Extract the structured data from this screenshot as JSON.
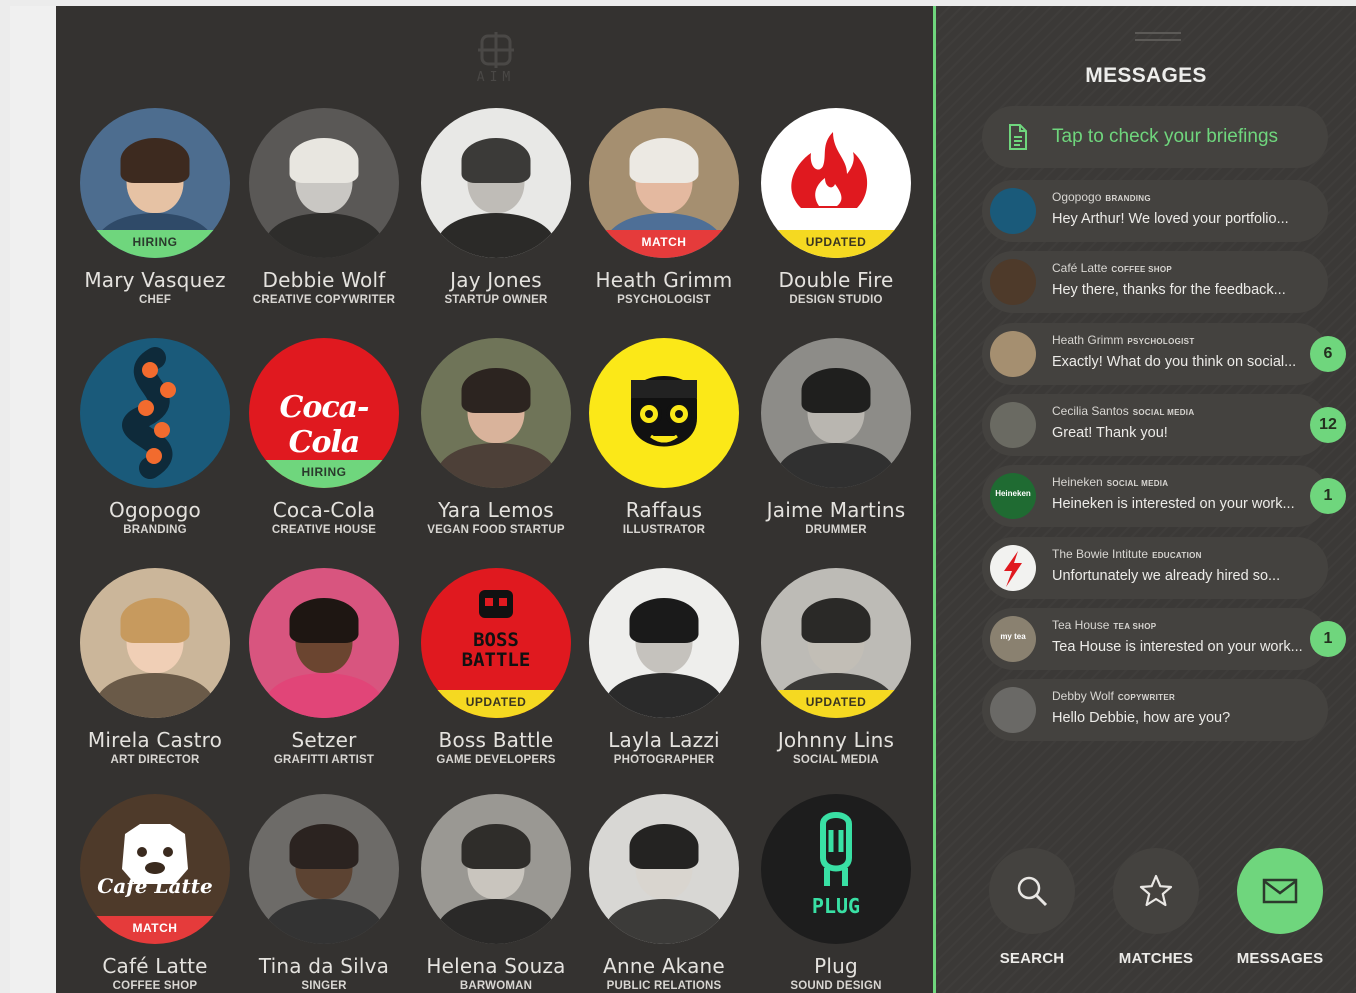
{
  "app": {
    "logo_text": "AIM"
  },
  "profiles": [
    {
      "name": "Mary Vasquez",
      "role": "CHEF",
      "badge": "HIRING",
      "badge_type": "hiring",
      "bg": "#4d6d8f",
      "skin": "#e6c2a4",
      "hair": "#3d2a1f",
      "shirt": "#2f4a68"
    },
    {
      "name": "Debbie Wolf",
      "role": "CREATIVE COPYWRITER",
      "badge": "",
      "badge_type": "",
      "bg": "#5a5856",
      "skin": "#c9c7c3",
      "hair": "#e8e6e0",
      "shirt": "#2e2d2b"
    },
    {
      "name": "Jay Jones",
      "role": "STARTUP OWNER",
      "badge": "",
      "badge_type": "",
      "bg": "#e8e8e6",
      "skin": "#bfbcb7",
      "hair": "#3b3a38",
      "shirt": "#2b2a28"
    },
    {
      "name": "Heath Grimm",
      "role": "PSYCHOLOGIST",
      "badge": "MATCH",
      "badge_type": "match",
      "bg": "#a58f70",
      "skin": "#e4b9a0",
      "hair": "#ece9e3",
      "shirt": "#4e6f97"
    },
    {
      "name": "Double Fire",
      "role": "DESIGN STUDIO",
      "badge": "UPDATED",
      "badge_type": "updated",
      "bg": "#ffffff",
      "logo": "fire"
    },
    {
      "name": "Ogopogo",
      "role": "BRANDING",
      "badge": "",
      "badge_type": "",
      "bg": "#1a5a7a",
      "logo": "ogopogo"
    },
    {
      "name": "Coca-Cola",
      "role": "CREATIVE HOUSE",
      "badge": "HIRING",
      "badge_type": "hiring",
      "bg": "#e0191f",
      "logo": "coke",
      "logo_text": "Coca-Cola"
    },
    {
      "name": "Yara Lemos",
      "role": "VEGAN FOOD STARTUP",
      "badge": "",
      "badge_type": "",
      "bg": "#6f7458",
      "skin": "#d9b39b",
      "hair": "#2c2420",
      "shirt": "#4d4038"
    },
    {
      "name": "Raffaus",
      "role": "ILLUSTRATOR",
      "badge": "",
      "badge_type": "",
      "bg": "#fbe818",
      "logo": "raffaus"
    },
    {
      "name": "Jaime Martins",
      "role": "DRUMMER",
      "badge": "",
      "badge_type": "",
      "bg": "#8d8c88",
      "skin": "#b9b6b0",
      "hair": "#1f1f1e",
      "shirt": "#303030"
    },
    {
      "name": "Mirela Castro",
      "role": "ART DIRECTOR",
      "badge": "",
      "badge_type": "",
      "bg": "#cbb69a",
      "skin": "#f0cfb6",
      "hair": "#c79a5e",
      "shirt": "#6a5a48"
    },
    {
      "name": "Setzer",
      "role": "GRAFITTI ARTIST",
      "badge": "",
      "badge_type": "",
      "bg": "#d8557f",
      "skin": "#6b4530",
      "hair": "#1e1612",
      "shirt": "#e14578"
    },
    {
      "name": "Boss Battle",
      "role": "GAME DEVELOPERS",
      "badge": "UPDATED",
      "badge_type": "updated",
      "bg": "#e0191f",
      "logo": "boss",
      "logo_text": "BOSS BATTLE"
    },
    {
      "name": "Layla Lazzi",
      "role": "PHOTOGRAPHER",
      "badge": "",
      "badge_type": "",
      "bg": "#eeeeec",
      "skin": "#c5c2bd",
      "hair": "#1a1a1a",
      "shirt": "#2a2a2a"
    },
    {
      "name": "Johnny Lins",
      "role": "SOCIAL MEDIA",
      "badge": "UPDATED",
      "badge_type": "updated",
      "bg": "#bdbbb6",
      "skin": "#c2beb6",
      "hair": "#2a2927",
      "shirt": "#3b3a38"
    },
    {
      "name": "Café Latte",
      "role": "COFFEE SHOP",
      "badge": "MATCH",
      "badge_type": "match",
      "bg": "#4e3a2a",
      "logo": "cafe",
      "logo_text": "Café Latte"
    },
    {
      "name": "Tina da Silva",
      "role": "SINGER",
      "badge": "",
      "badge_type": "",
      "bg": "#6d6b68",
      "skin": "#5c4332",
      "hair": "#2b2320",
      "shirt": "#333"
    },
    {
      "name": "Helena Souza",
      "role": "BARWOMAN",
      "badge": "",
      "badge_type": "",
      "bg": "#9a9893",
      "skin": "#c9c5be",
      "hair": "#2f2d2a",
      "shirt": "#2a2928"
    },
    {
      "name": "Anne Akane",
      "role": "PUBLIC RELATIONS",
      "badge": "",
      "badge_type": "",
      "bg": "#d8d7d4",
      "skin": "#d9d5cf",
      "hair": "#242322",
      "shirt": "#3c3b39"
    },
    {
      "name": "Plug",
      "role": "SOUND DESIGN",
      "badge": "",
      "badge_type": "",
      "bg": "#1d1d1d",
      "logo": "plug",
      "logo_text": "PLUG"
    }
  ],
  "messages_panel": {
    "title": "MESSAGES",
    "briefing_label": "Tap to check your briefings",
    "items": [
      {
        "sender": "Ogopogo",
        "type": "BRANDING",
        "preview": "Hey Arthur! We loved your portfolio...",
        "count": "",
        "avatar_bg": "#1a5a7a"
      },
      {
        "sender": "Café Latte",
        "type": "COFFEE SHOP",
        "preview": "Hey there, thanks for the feedback...",
        "count": "",
        "avatar_bg": "#4e3a2a"
      },
      {
        "sender": "Heath Grimm",
        "type": "PSYCHOLOGIST",
        "preview": "Exactly! What do you think on social...",
        "count": "6",
        "avatar_bg": "#a58f70"
      },
      {
        "sender": "Cecilia Santos",
        "type": "SOCIAL MEDIA",
        "preview": "Great! Thank you!",
        "count": "12",
        "avatar_bg": "#6a6a62"
      },
      {
        "sender": "Heineken",
        "type": "SOCIAL MEDIA",
        "preview": "Heineken is interested on your work...",
        "count": "1",
        "avatar_bg": "#1f6b32",
        "avatar_text": "Heineken"
      },
      {
        "sender": "The Bowie Intitute",
        "type": "EDUCATION",
        "preview": "Unfortunately we already hired so...",
        "count": "",
        "avatar_bg": "#f2f2f0"
      },
      {
        "sender": "Tea House",
        "type": "TEA SHOP",
        "preview": "Tea House is interested on your work...",
        "count": "1",
        "avatar_bg": "#8a8170",
        "avatar_text": "my tea"
      },
      {
        "sender": "Debby Wolf",
        "type": "COPYWRITER",
        "preview": "Hello Debbie, how are you?",
        "count": "",
        "avatar_bg": "#6a6966"
      }
    ]
  },
  "nav": [
    {
      "label": "SEARCH",
      "icon": "search-icon",
      "active": false
    },
    {
      "label": "MATCHES",
      "icon": "star-icon",
      "active": false
    },
    {
      "label": "MESSAGES",
      "icon": "envelope-icon",
      "active": true
    }
  ],
  "colors": {
    "accent": "#6fd67d",
    "panel": "#343230",
    "match": "#e53b3b",
    "updated": "#f5d921"
  }
}
